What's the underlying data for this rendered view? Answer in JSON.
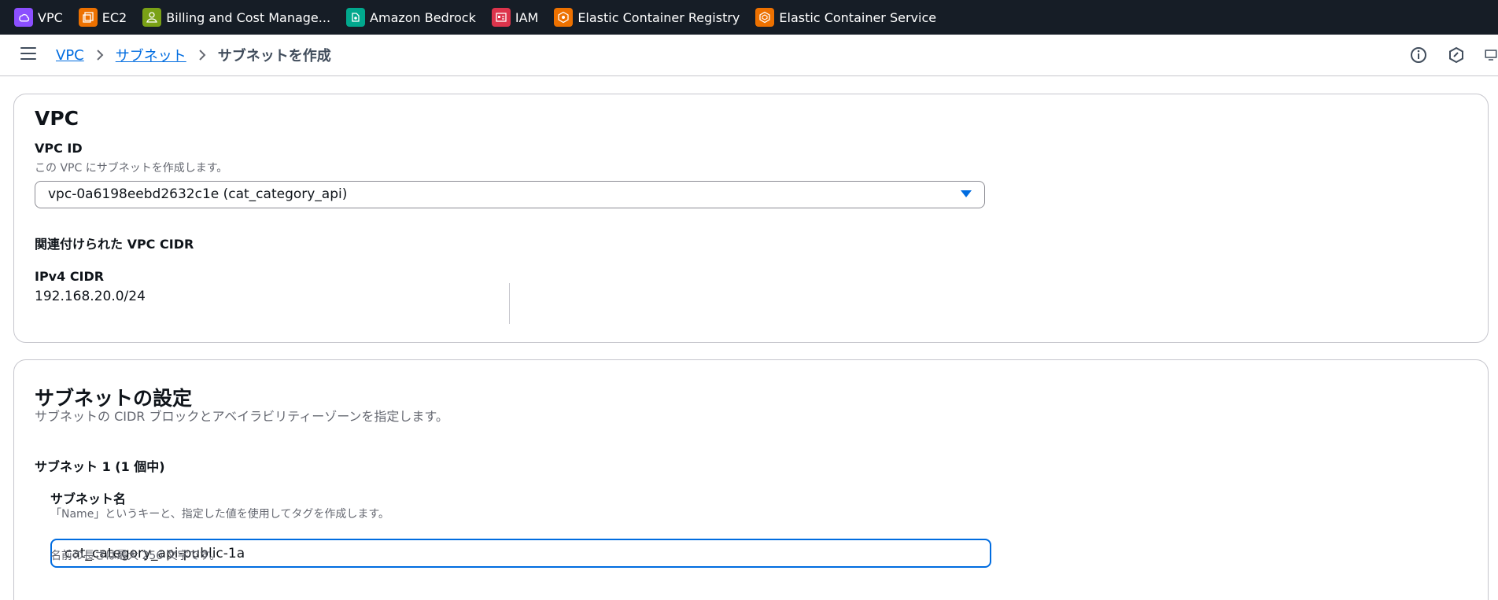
{
  "favorites": [
    {
      "label": "VPC",
      "icon": "vpc-icon",
      "color": "#8c4fff"
    },
    {
      "label": "EC2",
      "icon": "ec2-icon",
      "color": "#ed7100"
    },
    {
      "label": "Billing and Cost Manage...",
      "icon": "billing-icon",
      "color": "#7aa116"
    },
    {
      "label": "Amazon Bedrock",
      "icon": "bedrock-icon",
      "color": "#01a88d"
    },
    {
      "label": "IAM",
      "icon": "iam-icon",
      "color": "#dd344c"
    },
    {
      "label": "Elastic Container Registry",
      "icon": "ecr-icon",
      "color": "#ed7100"
    },
    {
      "label": "Elastic Container Service",
      "icon": "ecs-icon",
      "color": "#ed7100"
    }
  ],
  "breadcrumb": {
    "items": [
      "VPC",
      "サブネット"
    ],
    "current": "サブネットを作成"
  },
  "vpc_section": {
    "title": "VPC",
    "vpc_id_label": "VPC ID",
    "vpc_id_desc": "この VPC にサブネットを作成します。",
    "vpc_id_value": "vpc-0a6198eebd2632c1e (cat_category_api)",
    "cidr_heading": "関連付けられた VPC CIDR",
    "ipv4_label": "IPv4 CIDR",
    "ipv4_value": "192.168.20.0/24"
  },
  "subnet_section": {
    "title": "サブネットの設定",
    "desc": "サブネットの CIDR ブロックとアベイラビリティーゾーンを指定します。",
    "subnet_heading": "サブネット 1 (1 個中)",
    "name_label": "サブネット名",
    "name_desc": "「Name」というキーと、指定した値を使用してタグを作成します。",
    "name_value": "cat_category_api-public-1a",
    "name_hint": "名前の長さは最大 256 文字です。"
  },
  "colors": {
    "accent": "#006ce0",
    "topbar": "#161d26"
  }
}
